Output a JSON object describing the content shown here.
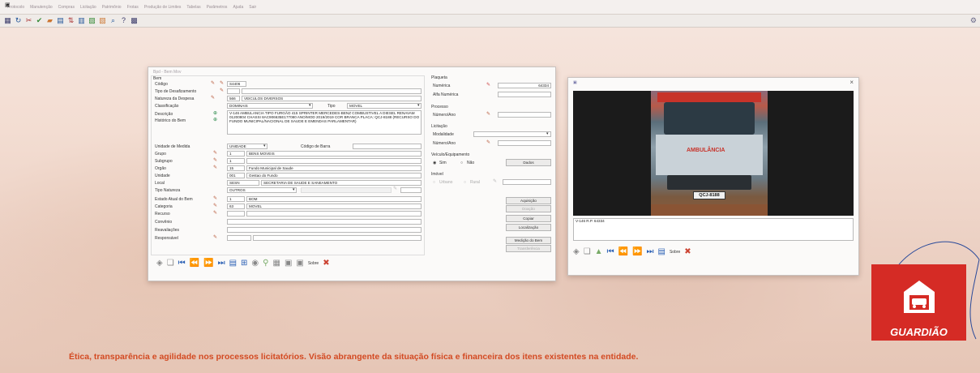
{
  "menubar": {
    "sys_icon": "app-icon",
    "items": [
      "Protocolo",
      "Manutenção",
      "Compras",
      "Licitação",
      "Patrimônio",
      "Frotas",
      "Produção de Limites",
      "Tabelas",
      "Parâmetros",
      "Ajuda",
      "Sair"
    ]
  },
  "toolbar": {
    "icons": [
      "database",
      "refresh",
      "cut",
      "check",
      "folder",
      "print",
      "sort",
      "calendar",
      "chart",
      "report",
      "search",
      "help"
    ]
  },
  "form": {
    "title": "Bpd - Bem Mov",
    "section_bem": "Bem",
    "labels": {
      "codigo": "Código",
      "tipo_desfaz": "Tipo de Desafizamento",
      "natureza": "Natureza da Despesa",
      "classificacao": "Classificação",
      "tipo": "Tipo",
      "descricao": "Descrição",
      "historico": "Histórico do Bem",
      "unidade_medida": "Unidade de Medida",
      "codigo_barra": "Código de Barra",
      "grupo": "Grupo",
      "subgrupo": "Subgrupo",
      "orgao": "Orgão",
      "unidade": "Unidade",
      "local": "Local",
      "tipo_natureza": "Tipo Natureza",
      "estado_atual": "Estado Atual do Bem",
      "categoria": "Categoria",
      "recurso": "Recurso",
      "convenio": "Convênio",
      "reavaliacoes": "Reavaliações",
      "responsavel": "Responsável"
    },
    "values": {
      "codigo": "S4406",
      "natureza_code": "566",
      "natureza_desc": "VEICULOS DIVERSOS",
      "classificacao": "DOMINAIS",
      "tipo": "MOVEL",
      "descricao": "V-146 AMBULANCIA TIPO FURGÃO 415 SPRINTER MERCEDES-BENZ COMBUSTIVEL A DIESEL RENAVAM 01200804 CHASSI 8AC906635E177080 ANO/MOD 2019/2019 COR BRANCA PLACA: QCJ-8188 (RECURSO DO FUNDO MUNICIPAL/NACIONAL DE SAUDE E EMENDAS PARLAMENTAR)",
      "unidade_medida": "UNIDADE",
      "grupo_code": "1",
      "grupo_desc": "BENS MOVEIS",
      "subgrupo_code": "1",
      "orgao_code": "15",
      "orgao_desc": "Fundo Municipal de Saude",
      "unidade_code": "001",
      "unidade_desc": "Gestao do Fundo",
      "local_code": "SESN",
      "local_desc": "SECRETARIA DE SAUDE E SANEAMENTO",
      "tipo_natureza": "OUTROS",
      "estado_code": "1",
      "estado_desc": "BOM",
      "categoria_code": "63",
      "categoria_desc": "MOVEL"
    },
    "plaqueta": {
      "title": "Plaqueta",
      "numerica_label": "Numérica",
      "numerica_value": "64334",
      "alfa_label": "Alfa Numérica"
    },
    "processo": {
      "title": "Processo",
      "numero_label": "Número/Ano"
    },
    "licitacao": {
      "title": "Licitação",
      "modalidade_label": "Modalidade",
      "numero_label": "Número/Ano"
    },
    "veiculo": {
      "title": "Veículo/Equipamento",
      "sim": "Sim",
      "nao": "Não",
      "dados_btn": "Dados"
    },
    "imovel": {
      "title": "Imóvel",
      "urbano": "Urbano",
      "rural": "Rural"
    },
    "side_buttons": [
      "Aquisição",
      "Doação",
      "Copiar",
      "Localização",
      "Medição do Bem",
      "Transferência"
    ],
    "nav_sobre": "Sobre"
  },
  "viewer": {
    "photo_caption": "V-146 R.P. 64334",
    "ambulance_text": "AMBULÂNCIA",
    "plate": "QCJ-8188",
    "nav_sobre": "Sobre"
  },
  "branding": {
    "name": "GUARDIÃO"
  },
  "footer_text": "Ética, transparência e agilidade nos processos licitatórios. Visão abrangente da situação física e financeira dos itens existentes na entidade.",
  "colors": {
    "accent": "#d52b25",
    "footer": "#d34a22"
  }
}
